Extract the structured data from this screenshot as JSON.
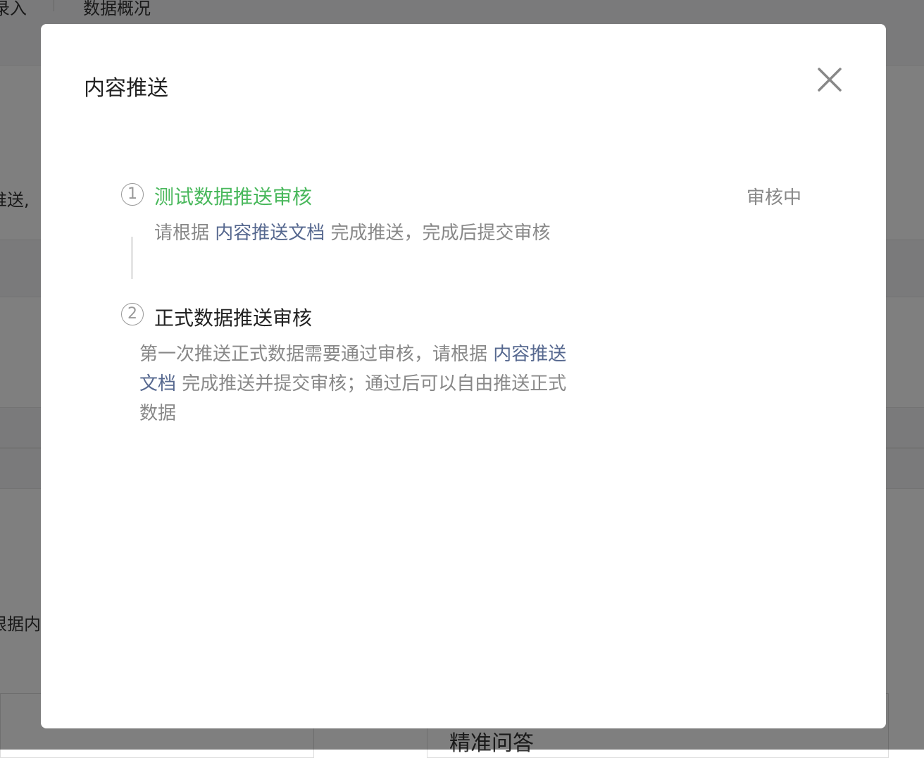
{
  "background": {
    "tab_left": "录入",
    "tab_data": "数据概况",
    "left_fragment_1": "推送,",
    "left_fragment_2": "根据内",
    "bottom_heading": "精准问答"
  },
  "modal": {
    "title": "内容推送",
    "close_icon": "close-icon",
    "steps": [
      {
        "number": "1",
        "title": "测试数据推送审核",
        "status": "审核中",
        "state": "active",
        "desc_prefix": "请根据 ",
        "desc_link": "内容推送文档",
        "desc_suffix": " 完成推送，完成后提交审核"
      },
      {
        "number": "2",
        "title": "正式数据推送审核",
        "state": "pending",
        "desc_prefix": "第一次推送正式数据需要通过审核，请根据 ",
        "desc_link": "内容推送文档",
        "desc_suffix": " 完成推送并提交审核；通过后可以自由推送正式数据"
      }
    ]
  },
  "colors": {
    "active_step": "#49b85c",
    "link": "#56688f",
    "muted_text": "#888888",
    "overlay": "rgba(0,0,0,0.5)"
  }
}
